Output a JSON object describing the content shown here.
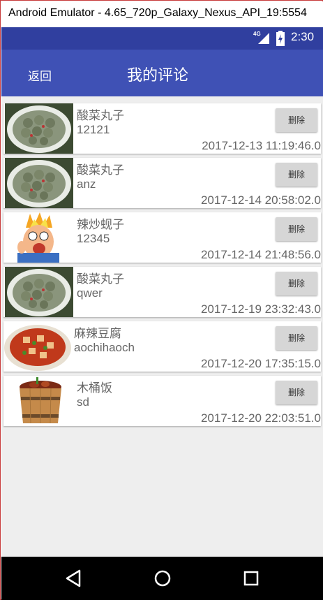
{
  "window": {
    "title": "Android Emulator - 4.65_720p_Galaxy_Nexus_API_19:5554"
  },
  "status_bar": {
    "network": "4G",
    "time": "2:30"
  },
  "app_bar": {
    "back_label": "返回",
    "title": "我的评论"
  },
  "delete_label": "删除",
  "comments": [
    {
      "dish": "酸菜丸子",
      "text": "12121",
      "time": "2017-12-13 11:19:46.0",
      "image": "meatball-soup-image"
    },
    {
      "dish": "酸菜丸子",
      "text": "anz",
      "time": "2017-12-14 20:58:02.0",
      "image": "meatball-soup-image"
    },
    {
      "dish": "辣炒蚬子",
      "text": "12345",
      "time": "2017-12-14 21:48:56.0",
      "image": "cartoon-face-image"
    },
    {
      "dish": "酸菜丸子",
      "text": "qwer",
      "time": "2017-12-19 23:32:43.0",
      "image": "meatball-soup-image"
    },
    {
      "dish": "麻辣豆腐",
      "text": "aochihaoch",
      "time": "2017-12-20 17:35:15.0",
      "image": "mapo-tofu-image"
    },
    {
      "dish": "木桶饭",
      "text": "sd",
      "time": "2017-12-20 22:03:51.0",
      "image": "bucket-rice-image"
    }
  ],
  "nav_bar": {
    "back": "back-icon",
    "home": "home-icon",
    "recents": "recents-icon"
  }
}
